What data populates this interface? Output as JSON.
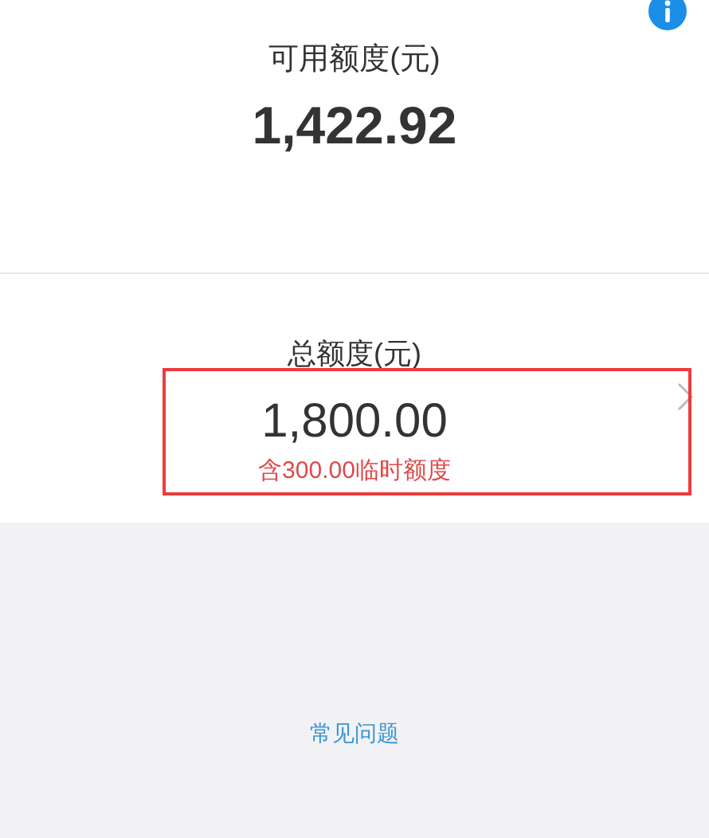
{
  "available": {
    "label": "可用额度(元)",
    "amount": "1,422.92"
  },
  "total": {
    "label": "总额度(元)",
    "amount": "1,800.00",
    "note": "含300.00临时额度",
    "highlighted": true
  },
  "faq_link": "常见问题"
}
